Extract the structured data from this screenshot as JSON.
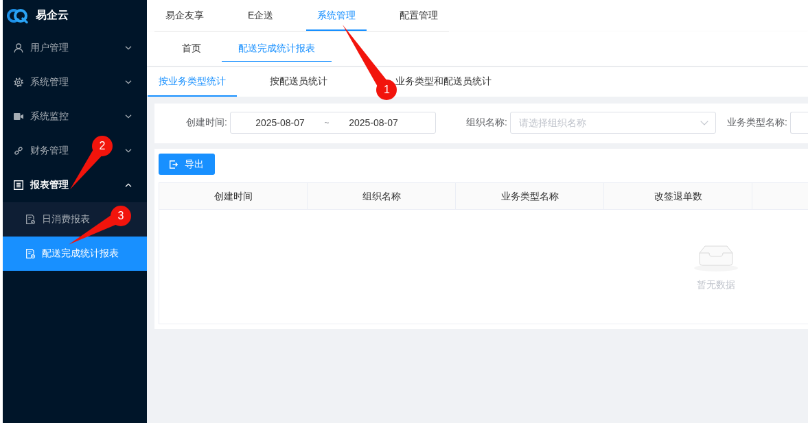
{
  "sidebar": {
    "logo_text": "易企云",
    "items": [
      {
        "label": "用户管理",
        "expanded": false
      },
      {
        "label": "系统管理",
        "expanded": false
      },
      {
        "label": "系统监控",
        "expanded": false
      },
      {
        "label": "财务管理",
        "expanded": false
      },
      {
        "label": "报表管理",
        "expanded": true,
        "annotation": "2",
        "children": [
          {
            "label": "日消费报表",
            "selected": false
          },
          {
            "label": "配送完成统计报表",
            "selected": true,
            "annotation": "3"
          }
        ]
      }
    ]
  },
  "top_nav": [
    {
      "label": "易企友享",
      "selected": false
    },
    {
      "label": "E企送",
      "selected": false
    },
    {
      "label": "系统管理",
      "selected": true,
      "annotation": "1"
    },
    {
      "label": "配置管理",
      "selected": false
    }
  ],
  "page_tabs": [
    {
      "label": "首页",
      "selected": false
    },
    {
      "label": "配送完成统计报表",
      "selected": true
    }
  ],
  "report_tabs": [
    {
      "label": "按业务类型统计",
      "selected": true
    },
    {
      "label": "按配送员统计",
      "selected": false
    },
    {
      "label": "业务类型和配送员统计",
      "selected": false
    }
  ],
  "filters": [
    {
      "kind": "date_range",
      "label": "创建时间:",
      "start": "2025-08-07",
      "separator": "~",
      "end": "2025-08-07"
    },
    {
      "kind": "select",
      "label": "组织名称:",
      "placeholder": "请选择组织名称"
    },
    {
      "kind": "input",
      "label": "业务类型名称:"
    }
  ],
  "toolbar": {
    "buttons": [
      {
        "label": "导出"
      }
    ]
  },
  "table": {
    "columns": [
      "创建时间",
      "组织名称",
      "业务类型名称",
      "改签退单数"
    ],
    "empty_text": "暂无数据"
  }
}
